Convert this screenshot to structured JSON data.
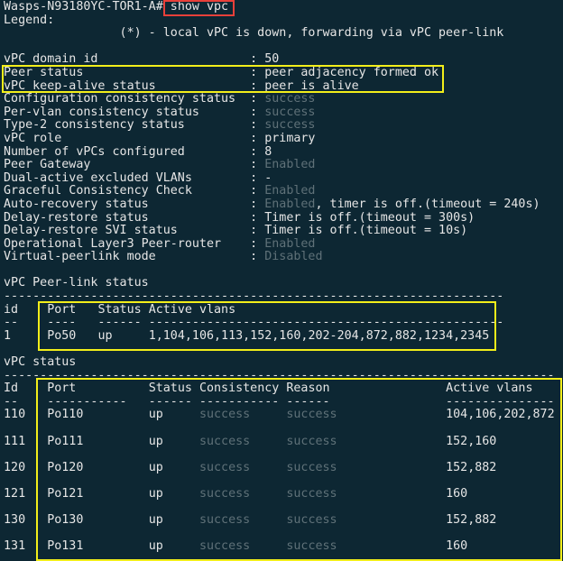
{
  "prompt": "Wasps-N93180YC-TOR1-A#",
  "command": "show vpc",
  "legend_title": "Legend:",
  "legend_text": "(*) - local vPC is down, forwarding via vPC peer-link",
  "summary": [
    {
      "label": "vPC domain id",
      "value": "50"
    },
    {
      "label": "Peer status",
      "value": "peer adjacency formed ok"
    },
    {
      "label": "vPC keep-alive status",
      "value": "peer is alive"
    },
    {
      "label": "Configuration consistency status",
      "value": "success",
      "dim": true
    },
    {
      "label": "Per-vlan consistency status",
      "value": "success",
      "dim": true
    },
    {
      "label": "Type-2 consistency status",
      "value": "success",
      "dim": true
    },
    {
      "label": "vPC role",
      "value": "primary"
    },
    {
      "label": "Number of vPCs configured",
      "value": "8"
    },
    {
      "label": "Peer Gateway",
      "value": "Enabled",
      "dim": true
    },
    {
      "label": "Dual-active excluded VLANs",
      "value": "-"
    },
    {
      "label": "Graceful Consistency Check",
      "value": "Enabled",
      "dim": true
    },
    {
      "label": "Auto-recovery status",
      "value": "Enabled",
      "dim": true,
      "suffix": ", timer is off.(timeout = 240s)"
    },
    {
      "label": "Delay-restore status",
      "value": "Timer is off.(timeout = 300s)"
    },
    {
      "label": "Delay-restore SVI status",
      "value": "Timer is off.(timeout = 10s)"
    },
    {
      "label": "Operational Layer3 Peer-router",
      "value": "Enabled",
      "dim": true
    },
    {
      "label": "Virtual-peerlink mode",
      "value": "Disabled",
      "dim": true
    }
  ],
  "peer_link": {
    "title": "vPC Peer-link status",
    "headers": [
      "id",
      "Port",
      "Status",
      "Active vlans"
    ],
    "rows": [
      {
        "id": "1",
        "port": "Po50",
        "status": "up",
        "vlans": "1,104,106,113,152,160,202-204,872,882,1234,2345"
      }
    ]
  },
  "vpc_status": {
    "title": "vPC status",
    "headers": [
      "Id",
      "Port",
      "Status",
      "Consistency",
      "Reason",
      "Active vlans"
    ],
    "rows": [
      {
        "id": "110",
        "port": "Po110",
        "status": "up",
        "consistency": "success",
        "reason": "success",
        "vlans": "104,106,202,872"
      },
      {
        "id": "111",
        "port": "Po111",
        "status": "up",
        "consistency": "success",
        "reason": "success",
        "vlans": "152,160"
      },
      {
        "id": "120",
        "port": "Po120",
        "status": "up",
        "consistency": "success",
        "reason": "success",
        "vlans": "152,882"
      },
      {
        "id": "121",
        "port": "Po121",
        "status": "up",
        "consistency": "success",
        "reason": "success",
        "vlans": "160"
      },
      {
        "id": "130",
        "port": "Po130",
        "status": "up",
        "consistency": "success",
        "reason": "success",
        "vlans": "152,882"
      },
      {
        "id": "131",
        "port": "Po131",
        "status": "up",
        "consistency": "success",
        "reason": "success",
        "vlans": "160"
      }
    ]
  },
  "colors": {
    "background": "#0d2733",
    "text": "#e6e6e6",
    "dim": "#5f7178",
    "highlight_red": "#e8403a",
    "highlight_yellow": "#f2ee1a"
  }
}
